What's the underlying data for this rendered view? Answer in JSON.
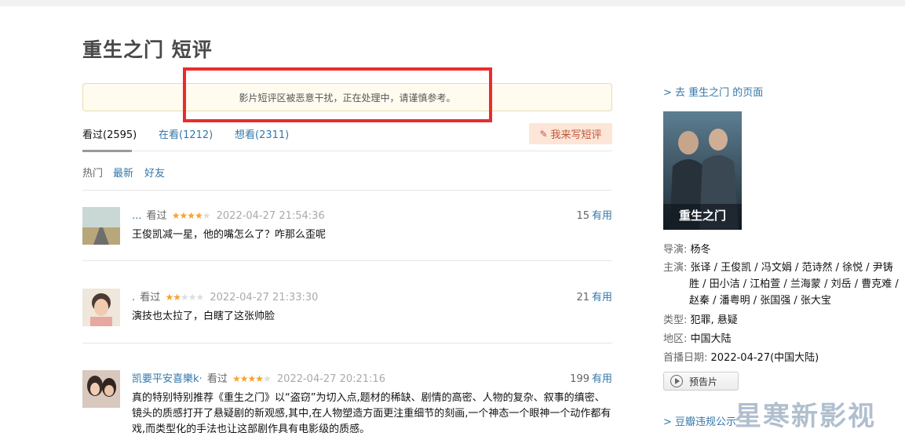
{
  "page": {
    "title": "重生之门 短评",
    "notice": "影片短评区被恶意干扰，正在处理中，请谨慎参考。"
  },
  "tabs": [
    {
      "label": "看过(2595)",
      "active": true
    },
    {
      "label": "在看(1212)",
      "active": false
    },
    {
      "label": "想看(2311)",
      "active": false
    }
  ],
  "write_button": {
    "label": "我来写短评",
    "icon": "pencil-icon"
  },
  "filters": [
    {
      "label": "热门",
      "active": true
    },
    {
      "label": "最新",
      "active": false
    },
    {
      "label": "好友",
      "active": false
    }
  ],
  "comments": [
    {
      "user": "...",
      "status": "看过",
      "rating": 4,
      "time": "2022-04-27 21:54:36",
      "votes": "15",
      "useful": "有用",
      "text": "王俊凯减一星，他的嘴怎么了？咋那么歪呢"
    },
    {
      "user": ".",
      "status": "看过",
      "rating": 2,
      "time": "2022-04-27 21:33:30",
      "votes": "21",
      "useful": "有用",
      "text": "演技也太拉了，白瞎了这张帅脸"
    },
    {
      "user": "凯要平安喜樂k·",
      "status": "看过",
      "rating": 4,
      "time": "2022-04-27 20:21:16",
      "votes": "199",
      "useful": "有用",
      "text": "真的特别特别推荐《重生之门》以“盗窃”为切入点,题材的稀缺、剧情的高密、人物的复杂、叙事的缜密、镜头的质感打开了悬疑剧的新观感,其中,在人物塑造方面更注重细节的刻画,一个神态一个眼神一个动作都有戏,而类型化的手法也让这部剧作具有电影级的质感。"
    }
  ],
  "sidebar": {
    "back_link": "> 去 重生之门 的页面",
    "poster_title": "重生之门",
    "director_label": "导演:",
    "director": "杨冬",
    "cast_label": "主演:",
    "cast": "张译 / 王俊凯 / 冯文娟 / 范诗然 / 徐悦 / 尹铸胜 / 田小洁 / 江柏萱 / 兰海蒙 / 刘岳 / 曹克难 / 赵秦 / 潘粤明 / 张国强 / 张大宝",
    "genre_label": "类型:",
    "genre": "犯罪, 悬疑",
    "region_label": "地区:",
    "region": "中国大陆",
    "premiere_label": "首播日期:",
    "premiere": "2022-04-27(中国大陆)",
    "trailer_label": "预告片",
    "report_link": "> 豆瓣违规公示"
  },
  "watermark": "星寒新影视",
  "colors": {
    "link": "#3377aa",
    "star": "#f7a32e",
    "highlight": "#ec2b2b",
    "write_bg": "#fde5d8"
  }
}
